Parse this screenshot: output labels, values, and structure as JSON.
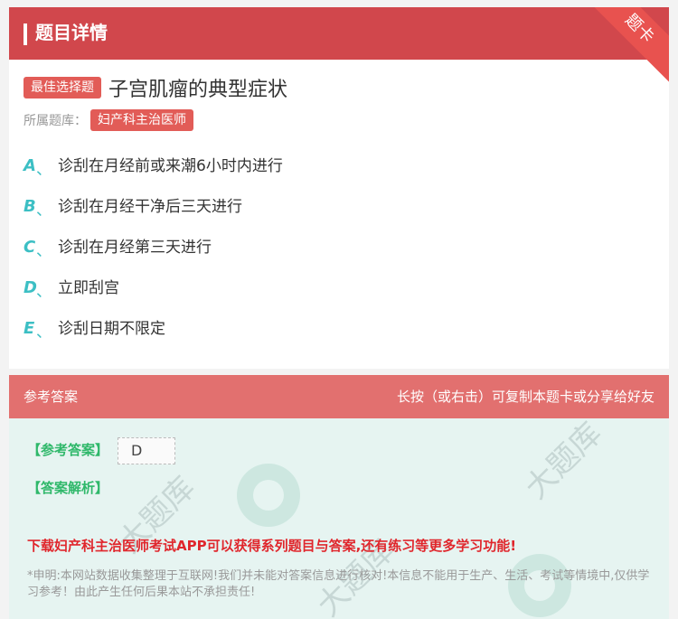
{
  "header": {
    "title": "题目详情",
    "ribbon": "题卡"
  },
  "question": {
    "type_tag": "最佳选择题",
    "text": "子宫肌瘤的典型症状",
    "category_label": "所属题库：",
    "category": "妇产科主治医师"
  },
  "options": [
    {
      "letter": "A",
      "sep": "、",
      "text": "诊刮在月经前或来潮6小时内进行"
    },
    {
      "letter": "B",
      "sep": "、",
      "text": "诊刮在月经干净后三天进行"
    },
    {
      "letter": "C",
      "sep": "、",
      "text": "诊刮在月经第三天进行"
    },
    {
      "letter": "D",
      "sep": "、",
      "text": "立即刮宫"
    },
    {
      "letter": "E",
      "sep": "、",
      "text": "诊刮日期不限定"
    }
  ],
  "answer_section": {
    "title": "参考答案",
    "hint": "长按（或右击）可复制本题卡或分享给好友",
    "answer_label": "【参考答案】",
    "answer_value": "D",
    "analysis_label": "【答案解析】",
    "promo": "下载妇产科主治医师考试APP可以获得系列题目与答案,还有练习等更多学习功能!",
    "disclaimer": "*申明:本网站数据收集整理于互联网!我们并未能对答案信息进行核对!本信息不能用于生产、生活、考试等情境中,仅供学习参考！由此产生任何后果本站不承担责任!"
  },
  "watermark": {
    "text": "大题库"
  }
}
